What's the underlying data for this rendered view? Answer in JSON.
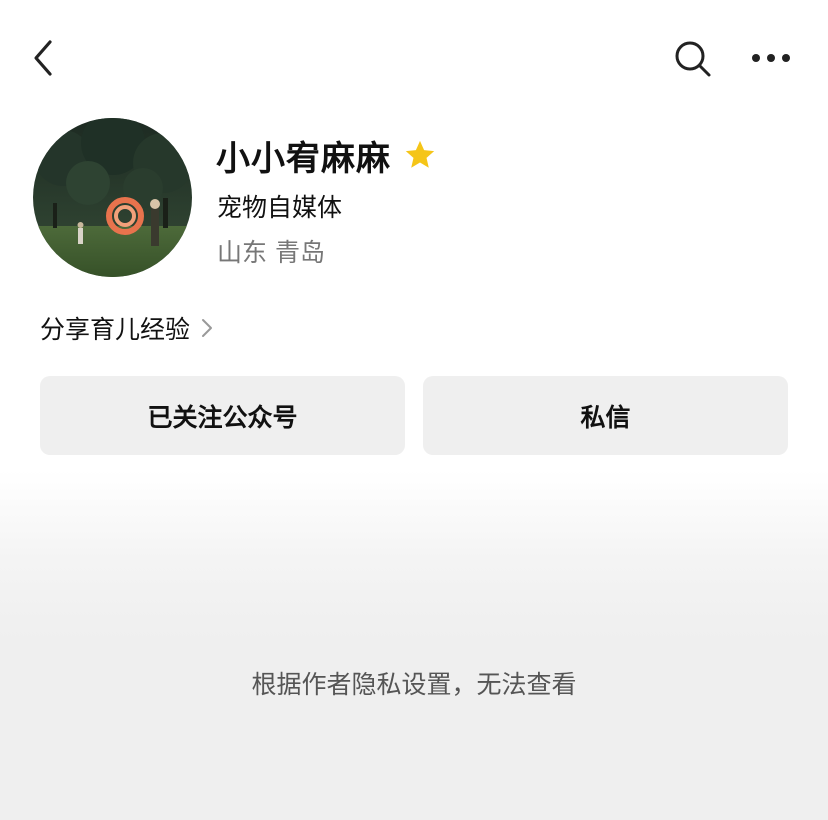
{
  "header": {
    "back_icon": "chevron-left-icon",
    "search_icon": "search-icon",
    "more_icon": "more-horizontal-icon"
  },
  "profile": {
    "name": "小小宥麻麻",
    "badge_icon": "star-icon",
    "badge_color": "#F5C518",
    "category": "宠物自媒体",
    "location": "山东 青岛",
    "bio": "分享育儿经验"
  },
  "actions": {
    "follow_label": "已关注公众号",
    "message_label": "私信"
  },
  "notice": {
    "privacy_text": "根据作者隐私设置，无法查看"
  }
}
